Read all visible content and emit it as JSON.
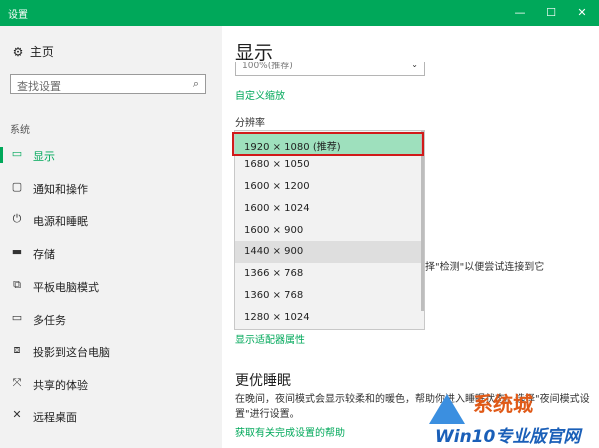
{
  "window": {
    "title": "设置",
    "minimize": "—",
    "maximize": "☐",
    "close": "✕"
  },
  "sidebar": {
    "home": "主页",
    "search_placeholder": "查找设置",
    "section": "系统",
    "items": [
      {
        "label": "显示",
        "icon": "monitor-icon",
        "glyph": "▭",
        "active": true
      },
      {
        "label": "通知和操作",
        "icon": "notification-icon",
        "glyph": "▢"
      },
      {
        "label": "电源和睡眠",
        "icon": "power-icon",
        "glyph": "⏻"
      },
      {
        "label": "存储",
        "icon": "storage-icon",
        "glyph": "▬"
      },
      {
        "label": "平板电脑模式",
        "icon": "tablet-icon",
        "glyph": "⧉"
      },
      {
        "label": "多任务",
        "icon": "multitask-icon",
        "glyph": "▭"
      },
      {
        "label": "投影到这台电脑",
        "icon": "project-icon",
        "glyph": "⧈"
      },
      {
        "label": "共享的体验",
        "icon": "share-icon",
        "glyph": "⤧"
      },
      {
        "label": "远程桌面",
        "icon": "remote-icon",
        "glyph": "✕"
      }
    ]
  },
  "main": {
    "title": "显示",
    "scale_value": "100%(推荐)",
    "custom_scaling": "自定义缩放",
    "resolution_label": "分辨率",
    "resolutions": [
      "1920 × 1080 (推荐)",
      "1680 × 1050",
      "1600 × 1200",
      "1600 × 1024",
      "1600 × 900",
      "1440 × 900",
      "1366 × 768",
      "1360 × 768",
      "1280 × 1024"
    ],
    "selected_index": 0,
    "hover_index": 5,
    "detect_partial": "择\"检测\"以便尝试连接到它",
    "adapter_link": "显示适配器属性",
    "sleep_title": "更优睡眠",
    "sleep_text": "在晚间，夜间模式会显示较柔和的暖色，帮助你进入睡眠状态。选择\"夜间模式设置\"进行设置。",
    "help_link": "获取有关完成设置的帮助"
  },
  "watermark": {
    "top": "系统城",
    "bottom": "Win10专业版官网"
  }
}
